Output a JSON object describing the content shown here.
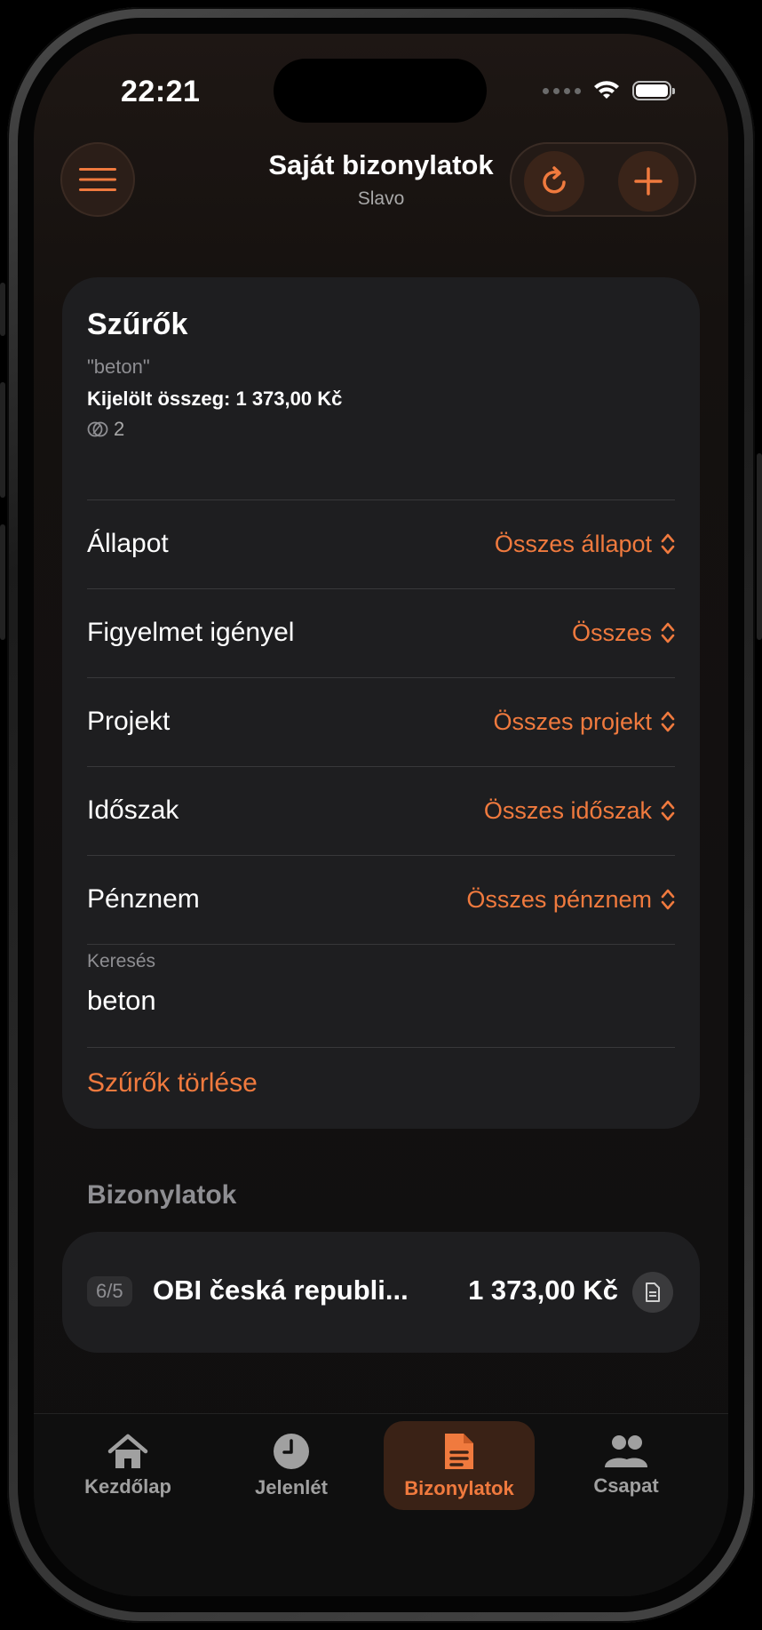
{
  "status_bar": {
    "time": "22:21"
  },
  "nav": {
    "title": "Saját bizonylatok",
    "subtitle": "Slavo"
  },
  "filters": {
    "title": "Szűrők",
    "query": "\"beton\"",
    "selected_sum": "Kijelölt összeg: 1 373,00 Kč",
    "count": "2",
    "rows": [
      {
        "label": "Állapot",
        "value": "Összes állapot"
      },
      {
        "label": "Figyelmet igényel",
        "value": "Összes"
      },
      {
        "label": "Projekt",
        "value": "Összes projekt"
      },
      {
        "label": "Időszak",
        "value": "Összes időszak"
      },
      {
        "label": "Pénznem",
        "value": "Összes pénznem"
      }
    ],
    "search_label": "Keresés",
    "search_value": "beton",
    "clear_label": "Szűrők törlése"
  },
  "documents": {
    "header": "Bizonylatok",
    "items": [
      {
        "badge": "6/5",
        "name": "OBI česká republi...",
        "amount": "1 373,00 Kč"
      }
    ]
  },
  "tabbar": {
    "items": [
      {
        "label": "Kezdőlap",
        "icon": "home-icon"
      },
      {
        "label": "Jelenlét",
        "icon": "clock-icon"
      },
      {
        "label": "Bizonylatok",
        "icon": "document-icon",
        "active": true
      },
      {
        "label": "Csapat",
        "icon": "people-icon"
      }
    ]
  },
  "colors": {
    "accent": "#f07a3e",
    "card": "#1e1e20",
    "background": "#121010"
  }
}
